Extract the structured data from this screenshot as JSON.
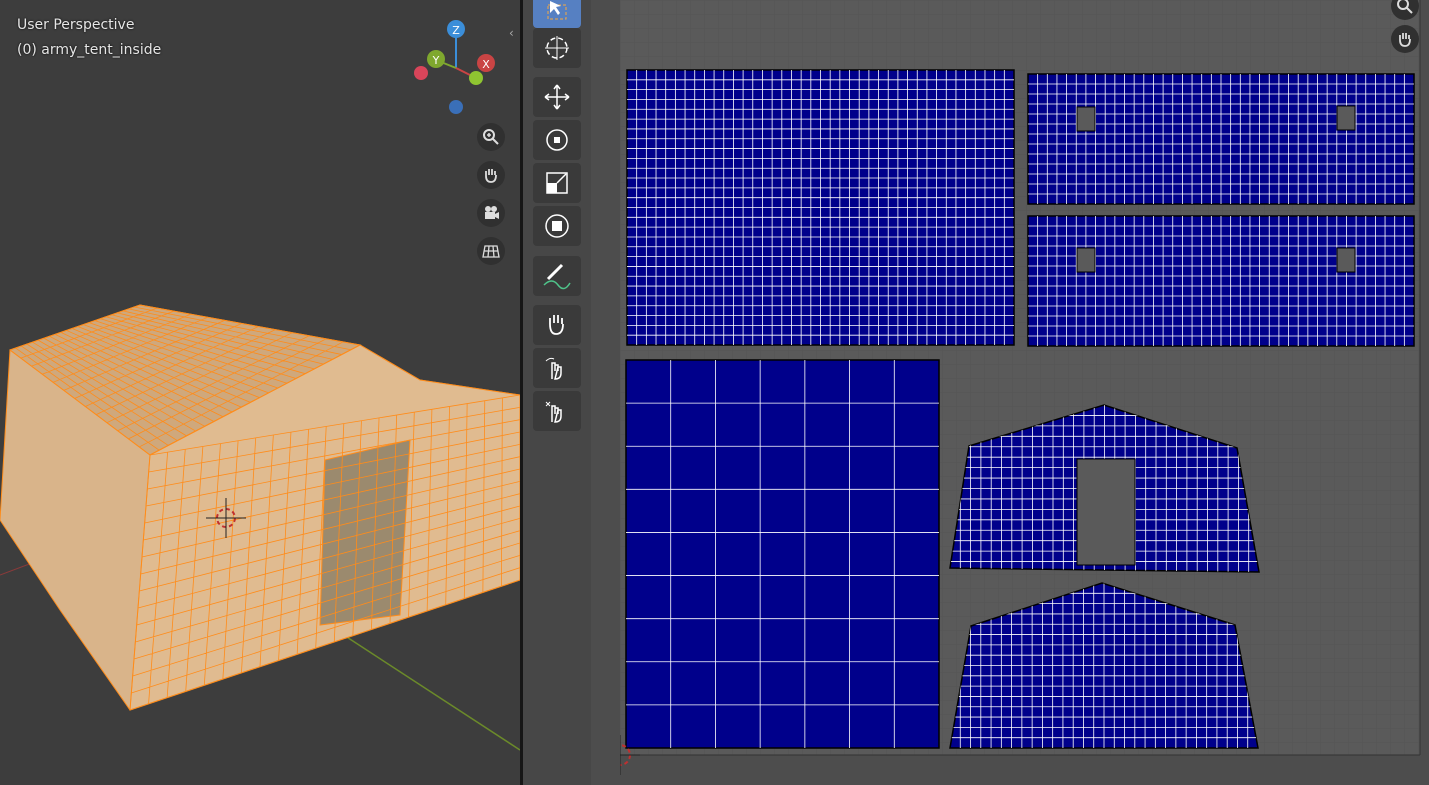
{
  "viewport3d": {
    "view_label": "User Perspective",
    "object_label": "(0) army_tent_inside",
    "gizmo": {
      "z": "Z",
      "y": "Y",
      "x": "X"
    },
    "nav_icons": [
      "zoom-icon",
      "hand-icon",
      "camera-icon",
      "grid-icon"
    ],
    "colors": {
      "mesh_fill": "#d9b48a",
      "wire": "#ff8c1a",
      "background": "#3d3d3d"
    }
  },
  "uv_editor": {
    "tools": [
      "select-box-icon",
      "cursor-icon",
      "move-icon",
      "rotate-icon",
      "scale-icon",
      "transform-icon",
      "annotate-icon",
      "grab-icon",
      "relax-icon",
      "pinch-icon"
    ],
    "colors": {
      "island_fill": "#00008b",
      "grid_background": "#5a5a5a",
      "uv_edge": "#ffffff"
    },
    "side_icons": [
      "zoom-icon",
      "hand-icon"
    ]
  }
}
